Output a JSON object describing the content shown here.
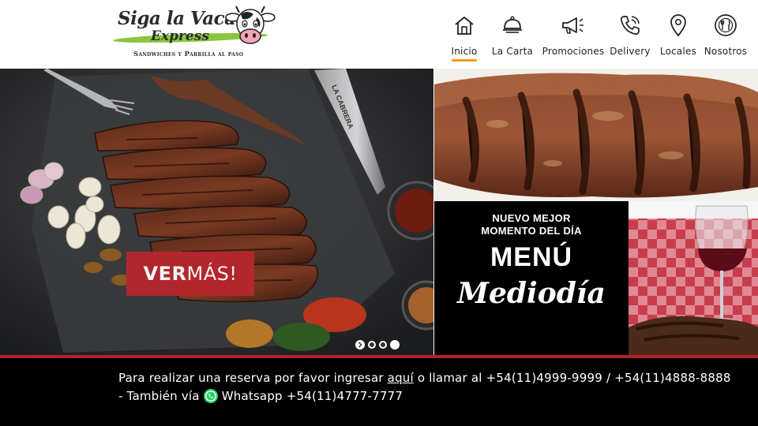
{
  "brand": {
    "title": "Siga la Vaca",
    "express": "Express",
    "subtitle": "Sandwiches y Parrilla al paso"
  },
  "nav": {
    "items": [
      {
        "label": "Inicio",
        "icon": "home-icon",
        "active": true
      },
      {
        "label": "La Carta",
        "icon": "cloche-icon",
        "active": false
      },
      {
        "label": "Promociones",
        "icon": "megaphone-icon",
        "active": false
      },
      {
        "label": "Delivery",
        "icon": "phone-icon",
        "active": false
      },
      {
        "label": "Locales",
        "icon": "location-pin-icon",
        "active": false
      },
      {
        "label": "Nosotros",
        "icon": "cutlery-plate-icon",
        "active": false
      }
    ],
    "active_color": "#f59a1c"
  },
  "hero": {
    "cta_bold": "VER",
    "cta_rest": "MÁS!",
    "knife_text": "LA CABRERA",
    "slides_count": 4,
    "active_slide": 1,
    "cta_color": "#b8262f"
  },
  "promo": {
    "kicker_line1": "NUEVO MEJOR",
    "kicker_line2": "MOMENTO DEL DÍA",
    "title": "MENÚ",
    "script": "Mediodía"
  },
  "footer": {
    "line1_pre": "Para realizar una reserva por favor ingresar ",
    "line1_link": "aquí",
    "line1_post": " o llamar al +54(11)4999-9999 / +54(11)4888-8888",
    "line2_pre": "- También vía ",
    "line2_post": " Whatsapp +54(11)4777-7777",
    "accent_color": "#b3202b"
  }
}
